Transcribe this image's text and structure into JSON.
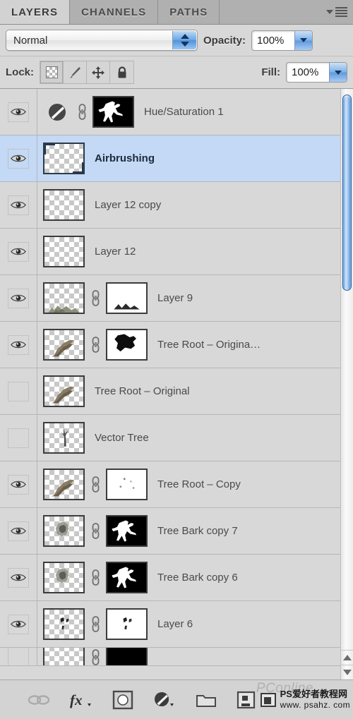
{
  "panel": {
    "tabs": [
      {
        "label": "LAYERS",
        "active": true
      },
      {
        "label": "CHANNELS",
        "active": false
      },
      {
        "label": "PATHS",
        "active": false
      }
    ],
    "menu_icon": "panel-menu-icon"
  },
  "blend": {
    "mode": "Normal",
    "opacity_label": "Opacity:",
    "opacity_value": "100%",
    "fill_label": "Fill:",
    "fill_value": "100%"
  },
  "lock": {
    "label": "Lock:",
    "buttons": [
      {
        "name": "lock-transparent-pixels",
        "icon": "checkerboard-icon",
        "active": true
      },
      {
        "name": "lock-image-pixels",
        "icon": "paintbrush-icon",
        "active": false
      },
      {
        "name": "lock-position",
        "icon": "move-arrows-icon",
        "active": false
      },
      {
        "name": "lock-all",
        "icon": "padlock-icon",
        "active": false
      }
    ]
  },
  "layers": [
    {
      "name": "Hue/Saturation 1",
      "visible": true,
      "selected": false,
      "adjustment_icon": true,
      "linked": true,
      "thumb": "adjustment",
      "mask": "black-figure"
    },
    {
      "name": "Airbrushing",
      "visible": true,
      "selected": true,
      "adjustment_icon": false,
      "linked": false,
      "thumb": "empty-checker",
      "mask": null
    },
    {
      "name": "Layer 12 copy",
      "visible": true,
      "selected": false,
      "adjustment_icon": false,
      "linked": false,
      "thumb": "empty-checker",
      "mask": null
    },
    {
      "name": "Layer 12",
      "visible": true,
      "selected": false,
      "adjustment_icon": false,
      "linked": false,
      "thumb": "faint-checker",
      "mask": null
    },
    {
      "name": "Layer 9",
      "visible": true,
      "selected": false,
      "adjustment_icon": false,
      "linked": true,
      "thumb": "grass-checker",
      "mask": "white-specks"
    },
    {
      "name": "Tree Root – Origina…",
      "visible": true,
      "selected": false,
      "adjustment_icon": false,
      "linked": true,
      "thumb": "root-checker",
      "mask": "white-blackshape"
    },
    {
      "name": "Tree Root – Original",
      "visible": false,
      "selected": false,
      "adjustment_icon": false,
      "linked": false,
      "thumb": "root-checker",
      "mask": null
    },
    {
      "name": "Vector Tree",
      "visible": false,
      "selected": false,
      "adjustment_icon": false,
      "linked": false,
      "thumb": "tree-checker",
      "mask": null
    },
    {
      "name": "Tree Root – Copy",
      "visible": true,
      "selected": false,
      "adjustment_icon": false,
      "linked": true,
      "thumb": "root-small-checker",
      "mask": "white-dots"
    },
    {
      "name": "Tree Bark copy 7",
      "visible": true,
      "selected": false,
      "adjustment_icon": false,
      "linked": true,
      "thumb": "bark-checker",
      "mask": "black-figure"
    },
    {
      "name": "Tree Bark copy 6",
      "visible": true,
      "selected": false,
      "adjustment_icon": false,
      "linked": true,
      "thumb": "bark-checker",
      "mask": "black-figure"
    },
    {
      "name": "Layer 6",
      "visible": true,
      "selected": false,
      "adjustment_icon": false,
      "linked": true,
      "thumb": "speck-checker",
      "mask": "white-marks"
    }
  ],
  "scrollbar": {
    "up_arrow": "scroll-up-arrow",
    "down_arrow": "scroll-down-arrow"
  },
  "bottom_toolbar": [
    {
      "name": "link-layers-button",
      "icon": "link-chain-icon"
    },
    {
      "name": "layer-style-button",
      "icon": "fx-icon"
    },
    {
      "name": "add-layer-mask-button",
      "icon": "mask-circle-icon"
    },
    {
      "name": "new-adjustment-layer-button",
      "icon": "half-circle-icon"
    },
    {
      "name": "new-group-button",
      "icon": "folder-icon"
    },
    {
      "name": "new-layer-button",
      "icon": "new-layer-icon"
    }
  ],
  "watermark": {
    "ghost": "PConline",
    "line1": "PS爱好者教程网",
    "line2": "www. psahz. com"
  }
}
